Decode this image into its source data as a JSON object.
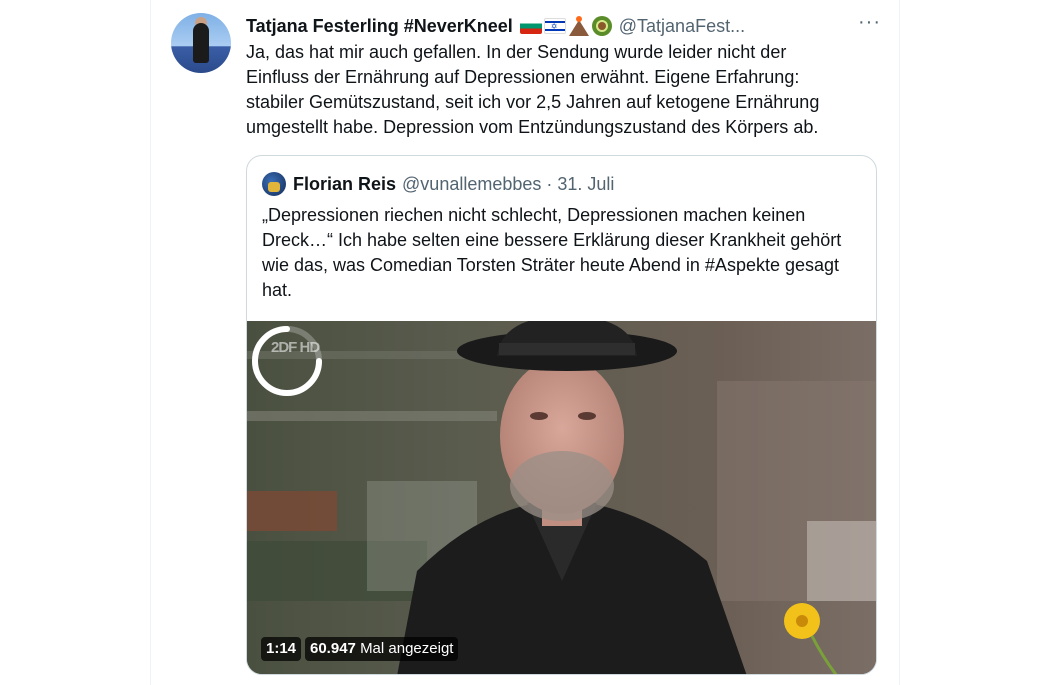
{
  "tweet": {
    "display_name": "Tatjana Festerling #NeverKneel",
    "flag_icons": [
      "bulgaria-flag-icon",
      "israel-flag-icon",
      "volcano-icon",
      "avocado-icon"
    ],
    "handle": "@TatjanaFest...",
    "more_icon": "more-dots-icon",
    "more_glyph": "···",
    "body_lines": [
      "Ja, das hat mir auch gefallen. In der Sendung wurde leider nicht der",
      "Einfluss der Ernährung auf Depressionen erwähnt. Eigene Erfahrung:",
      "stabiler Gemütszustand, seit ich vor 2,5 Jahren auf ketogene Ernährung",
      "umgestellt habe. Depression vom Entzündungszustand des Körpers ab."
    ]
  },
  "quote": {
    "name": "Florian Reis",
    "handle": "@vunallemebbes",
    "separator": "·",
    "date": "31. Juli",
    "text_lines": [
      "„Depressionen riechen nicht schlecht, Depressionen machen keinen",
      "Dreck…“ Ich habe selten eine bessere Erklärung dieser Krankheit gehört",
      "wie das, was Comedian Torsten Sträter heute Abend in #Aspekte gesagt",
      "hat."
    ],
    "video": {
      "channel_logo": "2DF HD",
      "duration": "1:14",
      "views_count": "60.947",
      "views_label": "Mal angezeigt",
      "loading_icon": "loading-spinner-icon"
    }
  },
  "colors": {
    "text_primary": "#0f1419",
    "text_secondary": "#536471",
    "border": "#cfd9de"
  }
}
